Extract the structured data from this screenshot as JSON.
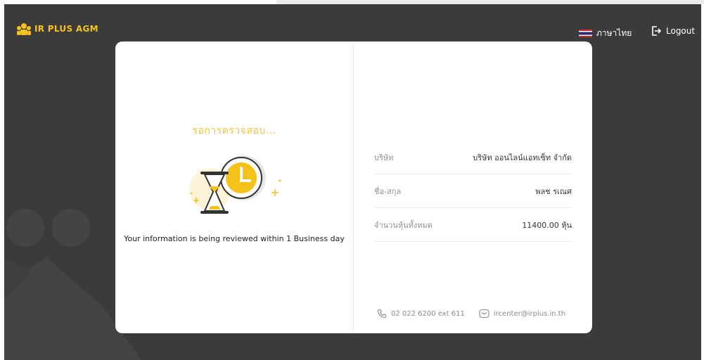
{
  "header": {
    "logo_text": "IR PLUS AGM",
    "language_label": "ภาษาไทย",
    "logout_label": "Logout"
  },
  "status": {
    "title": "รอการตรวจสอบ...",
    "message": "Your information is being reviewed within 1 Business day"
  },
  "details": {
    "rows": [
      {
        "label": "บริษัท",
        "value": "บริษัท ออนไลน์แอทเซ็ท จำกัด"
      },
      {
        "label": "ชื่อ-สกุล",
        "value": "พลช รเณศ"
      },
      {
        "label": "จำนวนหุ้นทั้งหมด",
        "value": "11400.00 หุ้น"
      }
    ]
  },
  "contact": {
    "phone": "02 022 6200 ext 611",
    "email": "ircenter@irplus.in.th"
  },
  "colors": {
    "accent": "#f4c21b",
    "background": "#3b3b3b",
    "card": "#ffffff"
  }
}
